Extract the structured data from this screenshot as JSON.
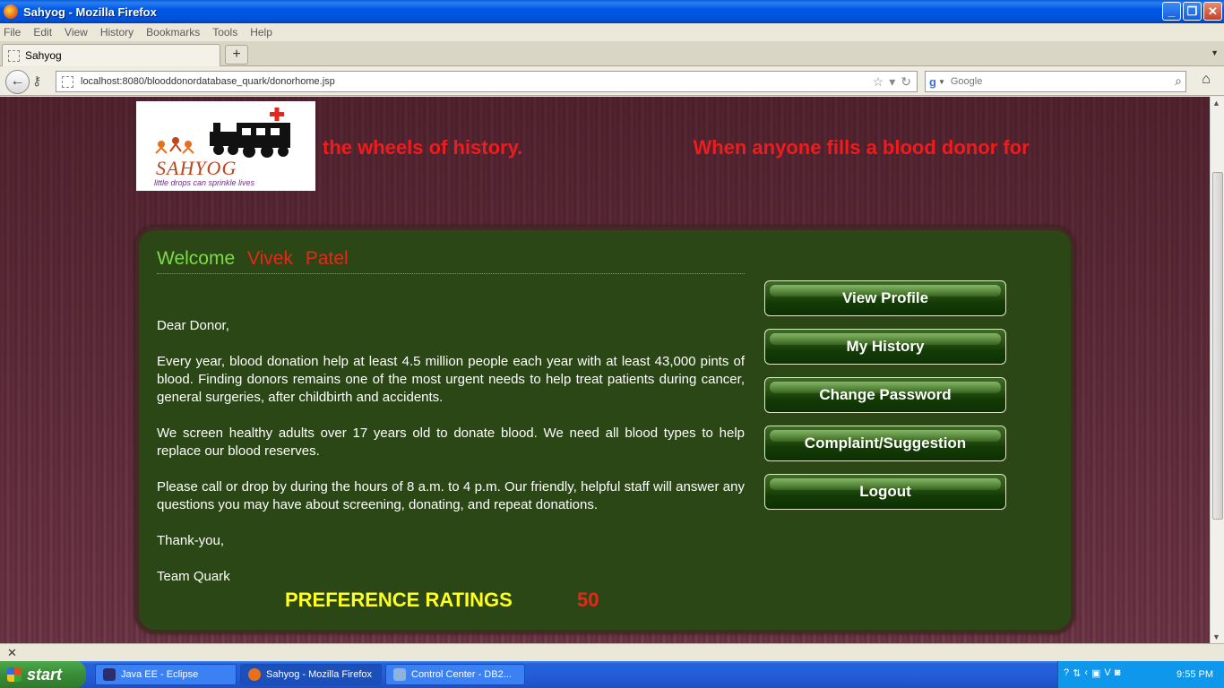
{
  "window": {
    "title": "Sahyog - Mozilla Firefox"
  },
  "menu": [
    "File",
    "Edit",
    "View",
    "History",
    "Bookmarks",
    "Tools",
    "Help"
  ],
  "tab": {
    "label": "Sahyog"
  },
  "nav": {
    "url": "localhost:8080/blooddonordatabase_quark/donorhome.jsp",
    "search_placeholder": "Google"
  },
  "page": {
    "logo": {
      "brand": "SAHYOG",
      "tagline": "little drops can sprinkle lives"
    },
    "marquee": [
      "the wheels of history.",
      "When anyone fills a blood donor for"
    ],
    "welcome": {
      "label": "Welcome",
      "first_name": "Vivek",
      "last_name": "Patel"
    },
    "letter": [
      "Dear Donor,",
      "Every year, blood donation help at least 4.5 million people each year with at least 43,000 pints of blood. Finding donors remains one of the most urgent needs to help treat patients during cancer, general surgeries, after childbirth and accidents.",
      "We screen healthy adults over 17 years old to donate blood. We need all blood types to help replace our blood reserves.",
      "Please call or drop by during the hours of 8 a.m. to 4 p.m. Our friendly, helpful staff will answer any questions you may have about screening, donating, and repeat donations.",
      "Thank-you,",
      "Team Quark"
    ],
    "preference": {
      "label": "PREFERENCE RATINGS",
      "value": "50"
    },
    "actions": [
      "View Profile",
      "My History",
      "Change Password",
      "Complaint/Suggestion",
      "Logout"
    ]
  },
  "taskbar": {
    "start": "start",
    "tasks": [
      "Java EE - Eclipse",
      "Sahyog - Mozilla Firefox",
      "Control Center - DB2..."
    ],
    "clock": "9:55 PM"
  },
  "colors": {
    "panel": "#2b4715",
    "accent_red": "#e8271a",
    "welcome_green": "#7fd94a",
    "pref_yellow": "#ffff22"
  }
}
